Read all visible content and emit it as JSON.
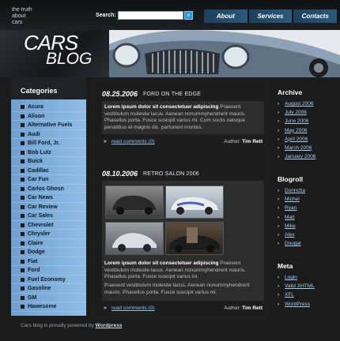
{
  "header": {
    "tagline": [
      "the truth",
      "about",
      "cars"
    ],
    "search_label": "Search:",
    "search_value": "",
    "search_button": "»",
    "nav": [
      "About",
      "Services",
      "Contacts"
    ]
  },
  "banner": {
    "logo_line1": "CARS",
    "logo_line2": "BLOG"
  },
  "categories": {
    "title": "Categories",
    "items": [
      "Acura",
      "Alison",
      "Alternative Fuels",
      "Audi",
      "Bill Ford, Jr.",
      "Bob Lutz",
      "Buick",
      "Cadillac",
      "Car Fun",
      "Carlos Ghosn",
      "Car News",
      "Car Review",
      "Car Sales",
      "Chevrolet",
      "Chrysler",
      "Claire",
      "Dodge",
      "Fiat",
      "Ford",
      "Fuel Economy",
      "Gasoline",
      "GM",
      "Hawesome"
    ]
  },
  "posts": [
    {
      "date": "08.25.2006",
      "title": "FORD ON THE EDGE",
      "lead": "Lorem ipsum dolor sit consectetuer adipiscing",
      "text": "Praesent vestibulum molestie lacus. Aenean nonummyhendrerit mauris. Phasellus porta. Fusce suscipit varius mi. Cum sociis natoque penatibus et magnis dis. parturient montes.",
      "read_more": "read comments",
      "comments": "(0)",
      "author_label": "Author:",
      "author": "Tim Rett"
    },
    {
      "date": "08.10.2006",
      "title": "RETRO SALON 2006",
      "lead": "Lorem ipsum dolor sit consectetuer adipiscing",
      "text": "Praesent vestibulum molestie lacus. Aenean nonummyhendrerit mauris. Phasellus porta. Fusce suscipit varius mi.",
      "text2": "Praesent vestibulum molestie lacus. Aenean nonummyhendrerit mauris. Phasellus porta. Fusce suscipit varius mi.",
      "read_more": "read comments",
      "comments": "(0)",
      "author_label": "Author:",
      "author": "Tim Rett"
    }
  ],
  "archive": {
    "title": "Archive",
    "items": [
      "August 2006",
      "July 2006",
      "June 2006",
      "May 2006",
      "April 2006",
      "March 2006",
      "January 2006"
    ]
  },
  "blogroll": {
    "title": "Blogroll",
    "items": [
      "Donncha",
      "Michel",
      "Ryan",
      "Matt",
      "Mike",
      "Alex",
      "Dougal"
    ]
  },
  "meta": {
    "title": "Meta",
    "items": [
      "Login",
      "Valid XHTML",
      "XFL",
      "WordPress"
    ]
  },
  "footer": {
    "text": "Cars blog is proudly powered by",
    "link": "Wordpress"
  },
  "colors": {
    "sidebar": "#8ebde6",
    "nav": "#2a5a7c",
    "link": "#a9cbec",
    "accent": "#2a9bd9"
  }
}
